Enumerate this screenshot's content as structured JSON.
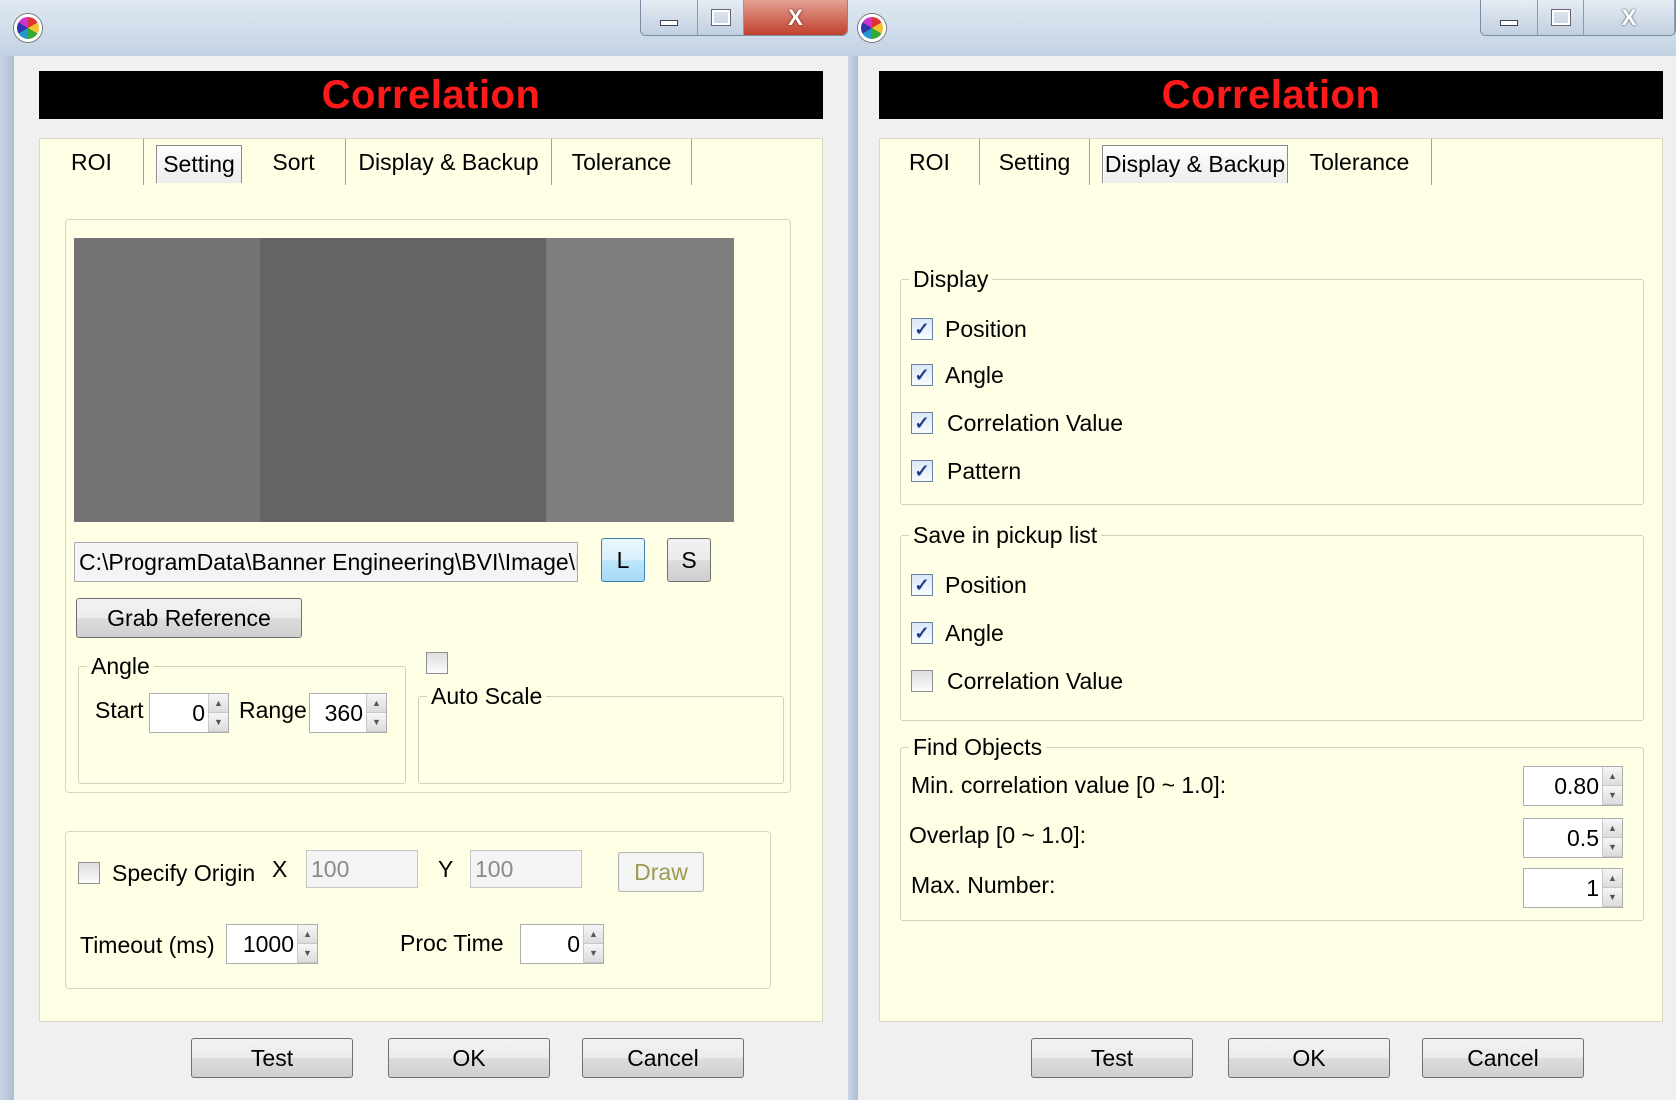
{
  "window_left": {
    "caption": {
      "minimize_icon": "minimize-icon",
      "maximize_icon": "maximize-icon",
      "close_label": "X"
    },
    "title": "Correlation",
    "tabs": [
      "ROI",
      "Setting",
      "Sort",
      "Display & Backup",
      "Tolerance"
    ],
    "active_tab": "Setting",
    "image_path": "C:\\ProgramData\\Banner Engineering\\BVI\\Image\\Re",
    "load_button": "L",
    "save_button": "S",
    "grab_reference": "Grab Reference",
    "angle_group": {
      "label": "Angle",
      "start_label": "Start",
      "start_value": "0",
      "range_label": "Range",
      "range_value": "360"
    },
    "auto_scale": {
      "label": "Auto Scale",
      "checked": false
    },
    "specify_origin": {
      "label": "Specify Origin",
      "checked": false,
      "x_label": "X",
      "x_value": "100",
      "y_label": "Y",
      "y_value": "100",
      "draw_button": "Draw"
    },
    "timeout": {
      "label": "Timeout (ms)",
      "value": "1000"
    },
    "proc_time": {
      "label": "Proc Time",
      "value": "0"
    },
    "buttons": {
      "test": "Test",
      "ok": "OK",
      "cancel": "Cancel"
    }
  },
  "window_right": {
    "caption": {
      "minimize_icon": "minimize-icon",
      "maximize_icon": "maximize-icon",
      "close_label": "X"
    },
    "title": "Correlation",
    "tabs": [
      "ROI",
      "Setting",
      "Display & Backup",
      "Tolerance"
    ],
    "active_tab": "Display & Backup",
    "display_group": {
      "label": "Display",
      "items": [
        {
          "label": "Position",
          "checked": true
        },
        {
          "label": "Angle",
          "checked": true
        },
        {
          "label": "Correlation Value",
          "checked": true
        },
        {
          "label": "Pattern",
          "checked": true
        }
      ]
    },
    "pickup_group": {
      "label": "Save in pickup list",
      "items": [
        {
          "label": "Position",
          "checked": true
        },
        {
          "label": "Angle",
          "checked": true
        },
        {
          "label": "Correlation Value",
          "checked": false
        }
      ]
    },
    "find_group": {
      "label": "Find Objects",
      "min_corr_label": "Min. correlation value [0 ~ 1.0]:",
      "min_corr_value": "0.80",
      "overlap_label": "Overlap [0 ~ 1.0]:",
      "overlap_value": "0.5",
      "max_number_label": "Max. Number:",
      "max_number_value": "1"
    },
    "buttons": {
      "test": "Test",
      "ok": "OK",
      "cancel": "Cancel"
    }
  },
  "colors": {
    "title_bg": "#000000",
    "title_text": "#ff1a1a",
    "panel_bg": "#ffffe6"
  }
}
